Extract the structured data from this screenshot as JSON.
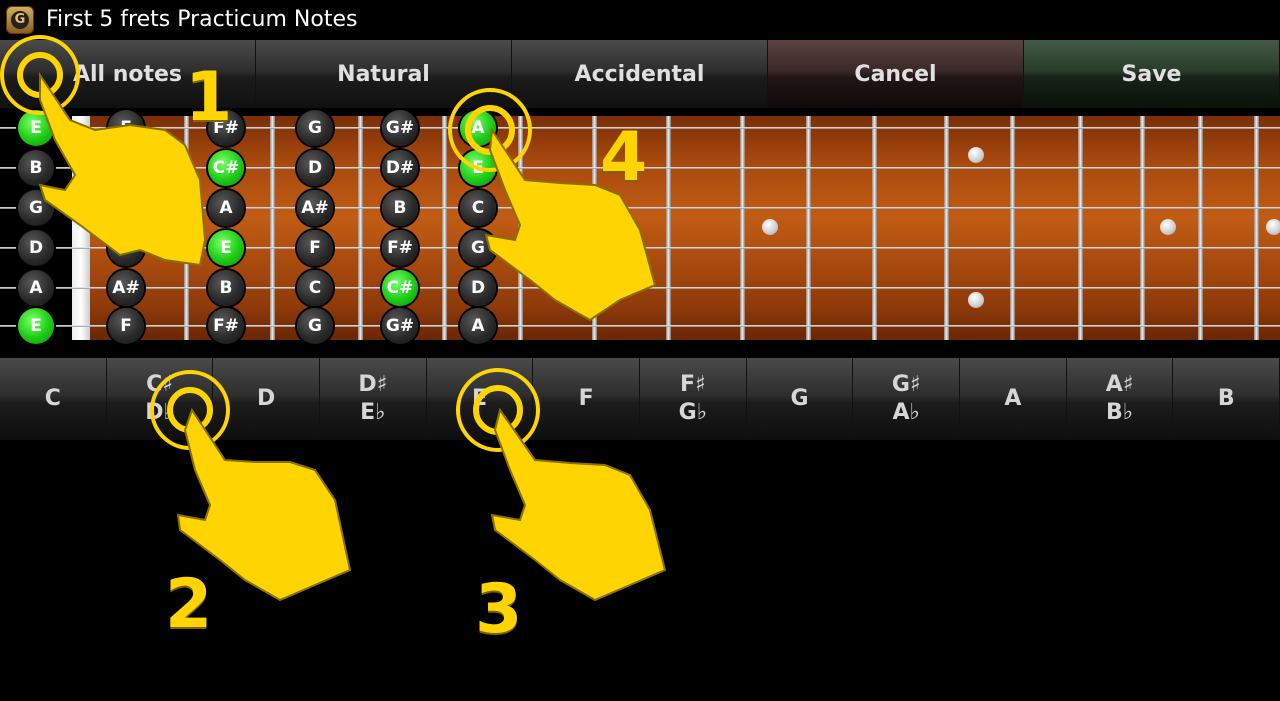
{
  "window": {
    "title": "First 5 frets Practicum Notes",
    "icon": "guitar-app-icon",
    "icon_letter": "G"
  },
  "toolbar": {
    "all_notes": "All notes",
    "natural": "Natural",
    "accidental": "Accidental",
    "cancel": "Cancel",
    "save": "Save"
  },
  "fretboard": {
    "open": [
      {
        "label": "E",
        "on": true
      },
      {
        "label": "B",
        "on": false
      },
      {
        "label": "G",
        "on": false
      },
      {
        "label": "D",
        "on": false
      },
      {
        "label": "A",
        "on": false
      },
      {
        "label": "E",
        "on": true
      }
    ],
    "fret1": [
      {
        "label": "F",
        "on": false
      },
      {
        "label": "",
        "on": false
      },
      {
        "label": "",
        "on": false
      },
      {
        "label": "",
        "on": false
      },
      {
        "label": "A#",
        "on": false
      },
      {
        "label": "F",
        "on": false
      }
    ],
    "fret2": [
      {
        "label": "F#",
        "on": false
      },
      {
        "label": "C#",
        "on": true
      },
      {
        "label": "A",
        "on": false
      },
      {
        "label": "E",
        "on": true
      },
      {
        "label": "B",
        "on": false
      },
      {
        "label": "F#",
        "on": false
      }
    ],
    "fret3": [
      {
        "label": "G",
        "on": false
      },
      {
        "label": "D",
        "on": false
      },
      {
        "label": "A#",
        "on": false
      },
      {
        "label": "F",
        "on": false
      },
      {
        "label": "C",
        "on": false
      },
      {
        "label": "G",
        "on": false
      }
    ],
    "fret4": [
      {
        "label": "G#",
        "on": false
      },
      {
        "label": "D#",
        "on": false
      },
      {
        "label": "B",
        "on": false
      },
      {
        "label": "F#",
        "on": false
      },
      {
        "label": "C#",
        "on": true
      },
      {
        "label": "G#",
        "on": false
      }
    ],
    "fret5": [
      {
        "label": "A",
        "on": true
      },
      {
        "label": "E",
        "on": true
      },
      {
        "label": "C",
        "on": false
      },
      {
        "label": "G",
        "on": false
      },
      {
        "label": "D",
        "on": false
      },
      {
        "label": "A",
        "on": false
      }
    ]
  },
  "notes_bar": [
    {
      "top": "C",
      "bottom": ""
    },
    {
      "top": "C♯",
      "bottom": "D♭"
    },
    {
      "top": "D",
      "bottom": ""
    },
    {
      "top": "D♯",
      "bottom": "E♭"
    },
    {
      "top": "E",
      "bottom": ""
    },
    {
      "top": "F",
      "bottom": ""
    },
    {
      "top": "F♯",
      "bottom": "G♭"
    },
    {
      "top": "G",
      "bottom": ""
    },
    {
      "top": "G♯",
      "bottom": "A♭"
    },
    {
      "top": "A",
      "bottom": ""
    },
    {
      "top": "A♯",
      "bottom": "B♭"
    },
    {
      "top": "B",
      "bottom": ""
    }
  ],
  "tutorial_steps": [
    "1",
    "2",
    "3",
    "4"
  ],
  "colors": {
    "note_active": "#22d11a",
    "note_idle": "#2a2a2a",
    "hint": "#ffd400"
  }
}
